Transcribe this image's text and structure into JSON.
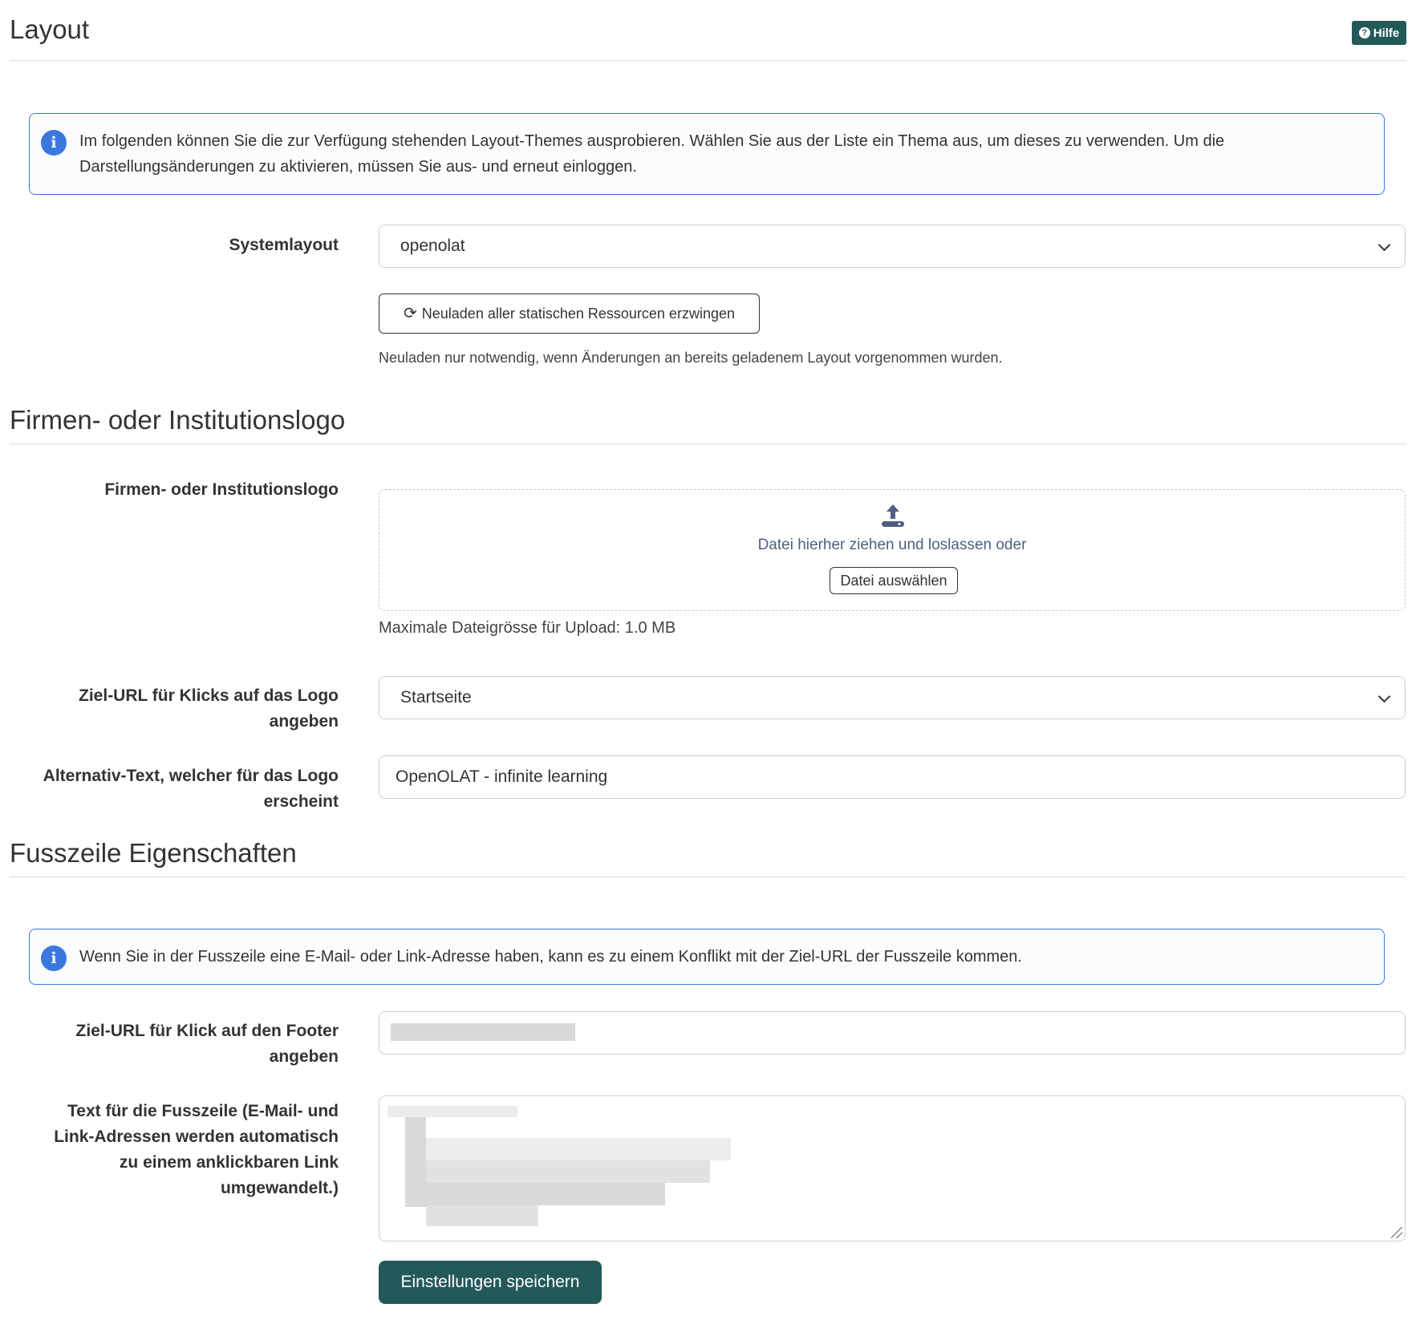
{
  "header": {
    "title": "Layout",
    "help_label": "Hilfe"
  },
  "layout_section": {
    "info_text": "Im folgenden können Sie die zur Verfügung stehenden Layout-Themes ausprobieren. Wählen Sie aus der Liste ein Thema aus, um dieses zu verwenden. Um die Darstellungsänderungen zu aktivieren, müssen Sie aus- und erneut einloggen.",
    "system_layout_label": "Systemlayout",
    "system_layout_value": "openolat",
    "reload_button_label": "Neuladen aller statischen Ressourcen erzwingen",
    "reload_hint": "Neuladen nur notwendig, wenn Änderungen an bereits geladenem Layout vorgenommen wurden."
  },
  "logo_section": {
    "title": "Firmen- oder Institutionslogo",
    "logo_label": "Firmen- oder Institutionslogo",
    "dropzone_text": "Datei hierher ziehen und loslassen oder",
    "choose_file_label": "Datei auswählen",
    "max_size_text": "Maximale Dateigrösse für Upload: 1.0 MB",
    "target_url_label_line1": "Ziel-URL für Klicks auf das Logo",
    "target_url_label_line2": "angeben",
    "target_url_value": "Startseite",
    "alt_text_label_line1": "Alternativ-Text, welcher für das Logo",
    "alt_text_label_line2": "erscheint",
    "alt_text_value": "OpenOLAT - infinite learning"
  },
  "footer_section": {
    "title": "Fusszeile Eigenschaften",
    "info_text": "Wenn Sie in der Fusszeile eine E-Mail- oder Link-Adresse haben, kann es zu einem Konflikt mit der Ziel-URL der Fusszeile kommen.",
    "footer_url_label_line1": "Ziel-URL für Klick auf den Footer",
    "footer_url_label_line2": "angeben",
    "footer_text_label_line1": "Text für die Fusszeile (E-Mail- und",
    "footer_text_label_line2": "Link-Adressen werden automatisch",
    "footer_text_label_line3": "zu einem anklickbaren Link",
    "footer_text_label_line4": "umgewandelt.)",
    "save_button_label": "Einstellungen speichern"
  },
  "colors": {
    "accent": "#24595a",
    "info_border": "#3a78e0",
    "info_icon": "#3a78e0"
  },
  "icons": [
    "help-icon",
    "info-icon",
    "chevron-down-icon",
    "reload-icon",
    "upload-icon",
    "resize-handle-icon"
  ]
}
